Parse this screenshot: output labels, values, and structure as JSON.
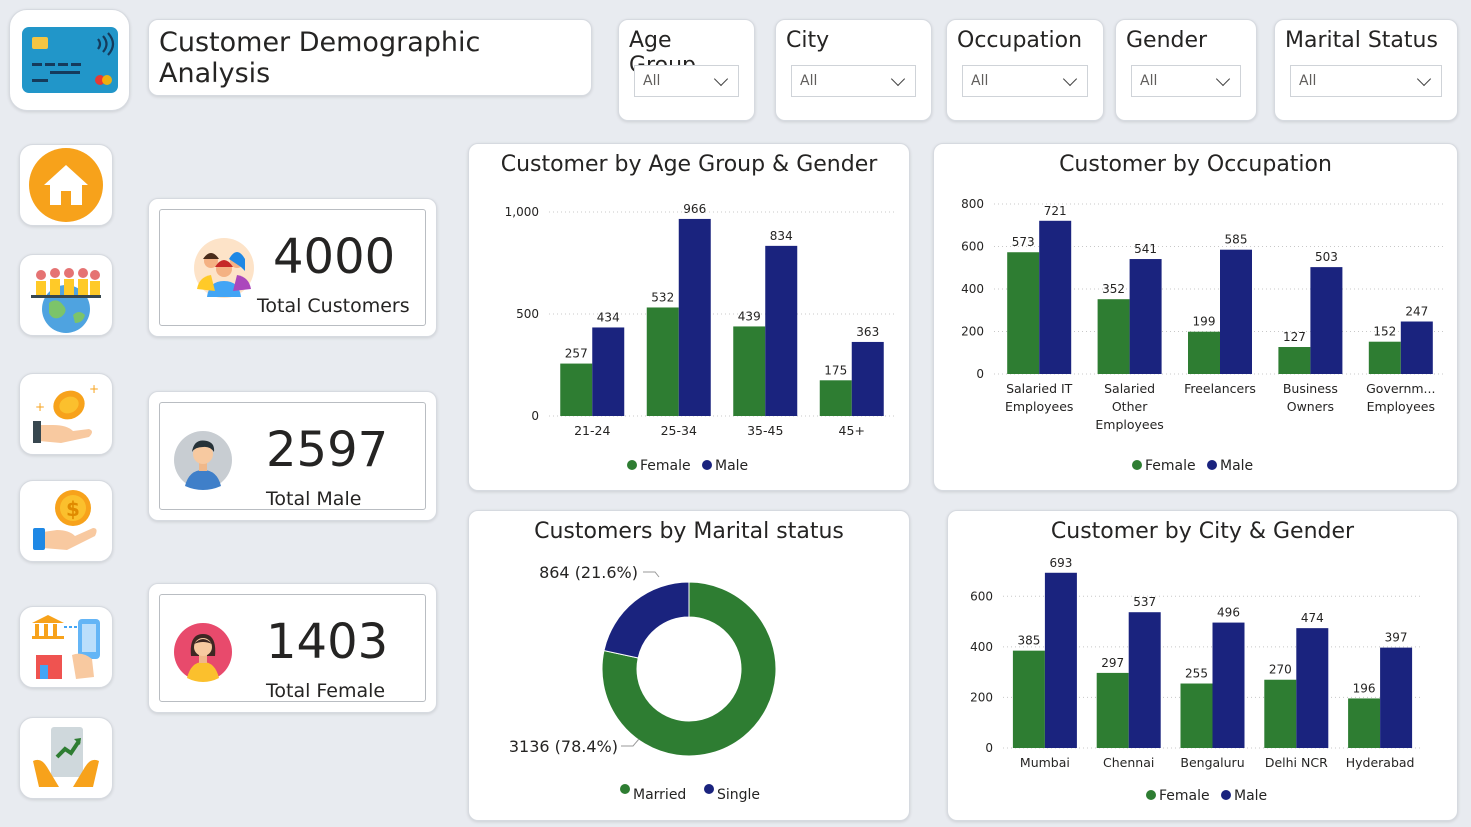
{
  "header": {
    "title": "Customer Demographic Analysis"
  },
  "filters": [
    {
      "label": "Age Group",
      "value": "All"
    },
    {
      "label": "City",
      "value": "All"
    },
    {
      "label": "Occupation",
      "value": "All"
    },
    {
      "label": "Gender",
      "value": "All"
    },
    {
      "label": "Marital Status",
      "value": "All"
    }
  ],
  "nav": [
    "home-icon",
    "people-globe-icon",
    "coin-hand-icon",
    "dollar-hand-icon",
    "bank-mobile-icon",
    "growth-hands-icon"
  ],
  "kpis": {
    "total_customers": {
      "value": "4000",
      "label": "Total Customers"
    },
    "total_male": {
      "value": "2597",
      "label": "Total Male"
    },
    "total_female": {
      "value": "1403",
      "label": "Total Female"
    }
  },
  "colors": {
    "female": "#2e7d32",
    "male": "#1a237e"
  },
  "chart_data": [
    {
      "type": "bar",
      "title": "Customer by Age Group & Gender",
      "categories": [
        "21-24",
        "25-34",
        "35-45",
        "45+"
      ],
      "series": [
        {
          "name": "Female",
          "values": [
            257,
            532,
            439,
            175
          ]
        },
        {
          "name": "Male",
          "values": [
            434,
            966,
            834,
            363
          ]
        }
      ],
      "ylim": [
        0,
        1000
      ],
      "yticks": [
        0,
        500,
        1000
      ],
      "ytick_labels": [
        "0",
        "500",
        "1,000"
      ],
      "legend": "bottom"
    },
    {
      "type": "bar",
      "title": "Customer by Occupation",
      "categories": [
        [
          "Salaried IT",
          "Employees"
        ],
        [
          "Salaried",
          "Other",
          "Employees"
        ],
        [
          "Freelancers"
        ],
        [
          "Business",
          "Owners"
        ],
        [
          "Governm...",
          "Employees"
        ]
      ],
      "series": [
        {
          "name": "Female",
          "values": [
            573,
            352,
            199,
            127,
            152
          ]
        },
        {
          "name": "Male",
          "values": [
            721,
            541,
            585,
            503,
            247
          ]
        }
      ],
      "ylim": [
        0,
        800
      ],
      "yticks": [
        0,
        200,
        400,
        600,
        800
      ],
      "ytick_labels": [
        "0",
        "200",
        "400",
        "600",
        "800"
      ],
      "legend": "bottom"
    },
    {
      "type": "pie",
      "title": "Customers by Marital status",
      "donut": true,
      "slices": [
        {
          "name": "Married",
          "value": 3136,
          "label": "3136 (78.4%)"
        },
        {
          "name": "Single",
          "value": 864,
          "label": "864 (21.6%)"
        }
      ],
      "legend": "bottom"
    },
    {
      "type": "bar",
      "title": "Customer by City & Gender",
      "categories": [
        "Mumbai",
        "Chennai",
        "Bengaluru",
        "Delhi NCR",
        "Hyderabad"
      ],
      "series": [
        {
          "name": "Female",
          "values": [
            385,
            297,
            255,
            270,
            196
          ]
        },
        {
          "name": "Male",
          "values": [
            693,
            537,
            496,
            474,
            397
          ]
        }
      ],
      "ylim": [
        0,
        700
      ],
      "yticks": [
        0,
        200,
        400,
        600
      ],
      "ytick_labels": [
        "0",
        "200",
        "400",
        "600"
      ],
      "legend": "bottom"
    }
  ]
}
